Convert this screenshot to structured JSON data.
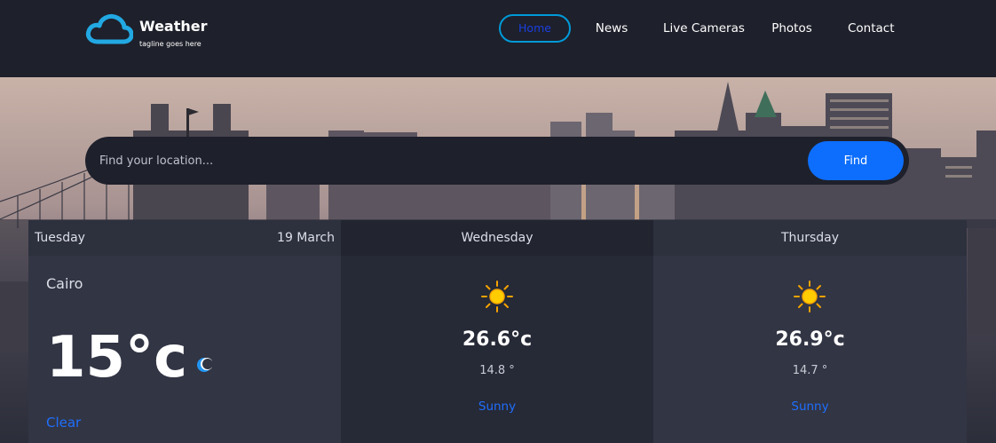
{
  "brand": {
    "title": "Weather",
    "tagline": "tagline goes here",
    "logo_icon": "cloud-icon"
  },
  "nav": [
    {
      "label": "Home",
      "active": true
    },
    {
      "label": "News",
      "active": false
    },
    {
      "label": "Live Cameras",
      "active": false
    },
    {
      "label": "Photos",
      "active": false
    },
    {
      "label": "Contact",
      "active": false
    }
  ],
  "search": {
    "placeholder": "Find your location...",
    "value": "",
    "button_label": "Find"
  },
  "forecast": {
    "today": {
      "day": "Tuesday",
      "date": "19 March",
      "city": "Cairo",
      "temp": "15",
      "unit": "°c",
      "condition": "Clear",
      "icon": "moon-icon"
    },
    "days": [
      {
        "day": "Wednesday",
        "max": "26.6°c",
        "min": "14.8 °",
        "condition": "Sunny",
        "icon": "sun-icon"
      },
      {
        "day": "Thursday",
        "max": "26.9°c",
        "min": "14.7 °",
        "condition": "Sunny",
        "icon": "sun-icon"
      }
    ]
  },
  "colors": {
    "background": "#1e202b",
    "accent_blue": "#0d6efd",
    "nav_active_border": "#009ad8",
    "card_light": "#323544",
    "card_dark": "#262936"
  }
}
